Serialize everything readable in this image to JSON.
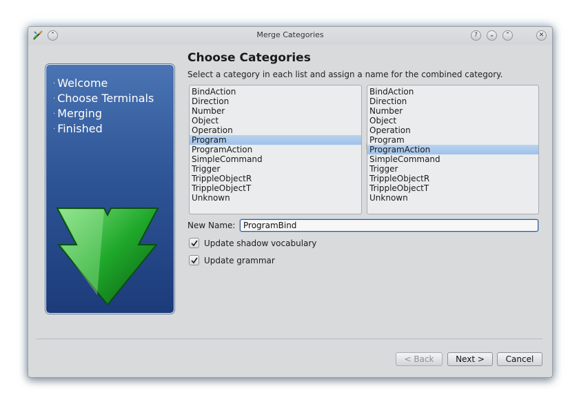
{
  "window": {
    "title": "Merge Categories"
  },
  "titlebar": {
    "help_glyph": "?",
    "minimize_glyph": "⌄",
    "maximize_glyph": "⌃",
    "close_glyph": "✕",
    "shade_glyph": "⌃"
  },
  "sidebar": {
    "steps": [
      {
        "label": "Welcome"
      },
      {
        "label": "Choose Terminals"
      },
      {
        "label": "Merging"
      },
      {
        "label": "Finished"
      }
    ],
    "bullet": "·"
  },
  "main": {
    "heading": "Choose Categories",
    "subtitle": "Select a category in each list and assign a name for the combined category.",
    "left_list": {
      "items": [
        "BindAction",
        "Direction",
        "Number",
        "Object",
        "Operation",
        "Program",
        "ProgramAction",
        "SimpleCommand",
        "Trigger",
        "TrippleObjectR",
        "TrippleObjectT",
        "Unknown"
      ],
      "selected": "Program"
    },
    "right_list": {
      "items": [
        "BindAction",
        "Direction",
        "Number",
        "Object",
        "Operation",
        "Program",
        "ProgramAction",
        "SimpleCommand",
        "Trigger",
        "TrippleObjectR",
        "TrippleObjectT",
        "Unknown"
      ],
      "selected": "ProgramAction"
    },
    "new_name_label": "New Name:",
    "new_name_value": "ProgramBind",
    "check_shadow": {
      "label": "Update shadow vocabulary",
      "checked": true
    },
    "check_grammar": {
      "label": "Update grammar",
      "checked": true
    }
  },
  "buttons": {
    "back": "< Back",
    "next": "Next >",
    "cancel": "Cancel"
  },
  "colors": {
    "selection": "#a9c8ec",
    "sidebar": "#2e5596",
    "arrow": "#1fa82a"
  }
}
